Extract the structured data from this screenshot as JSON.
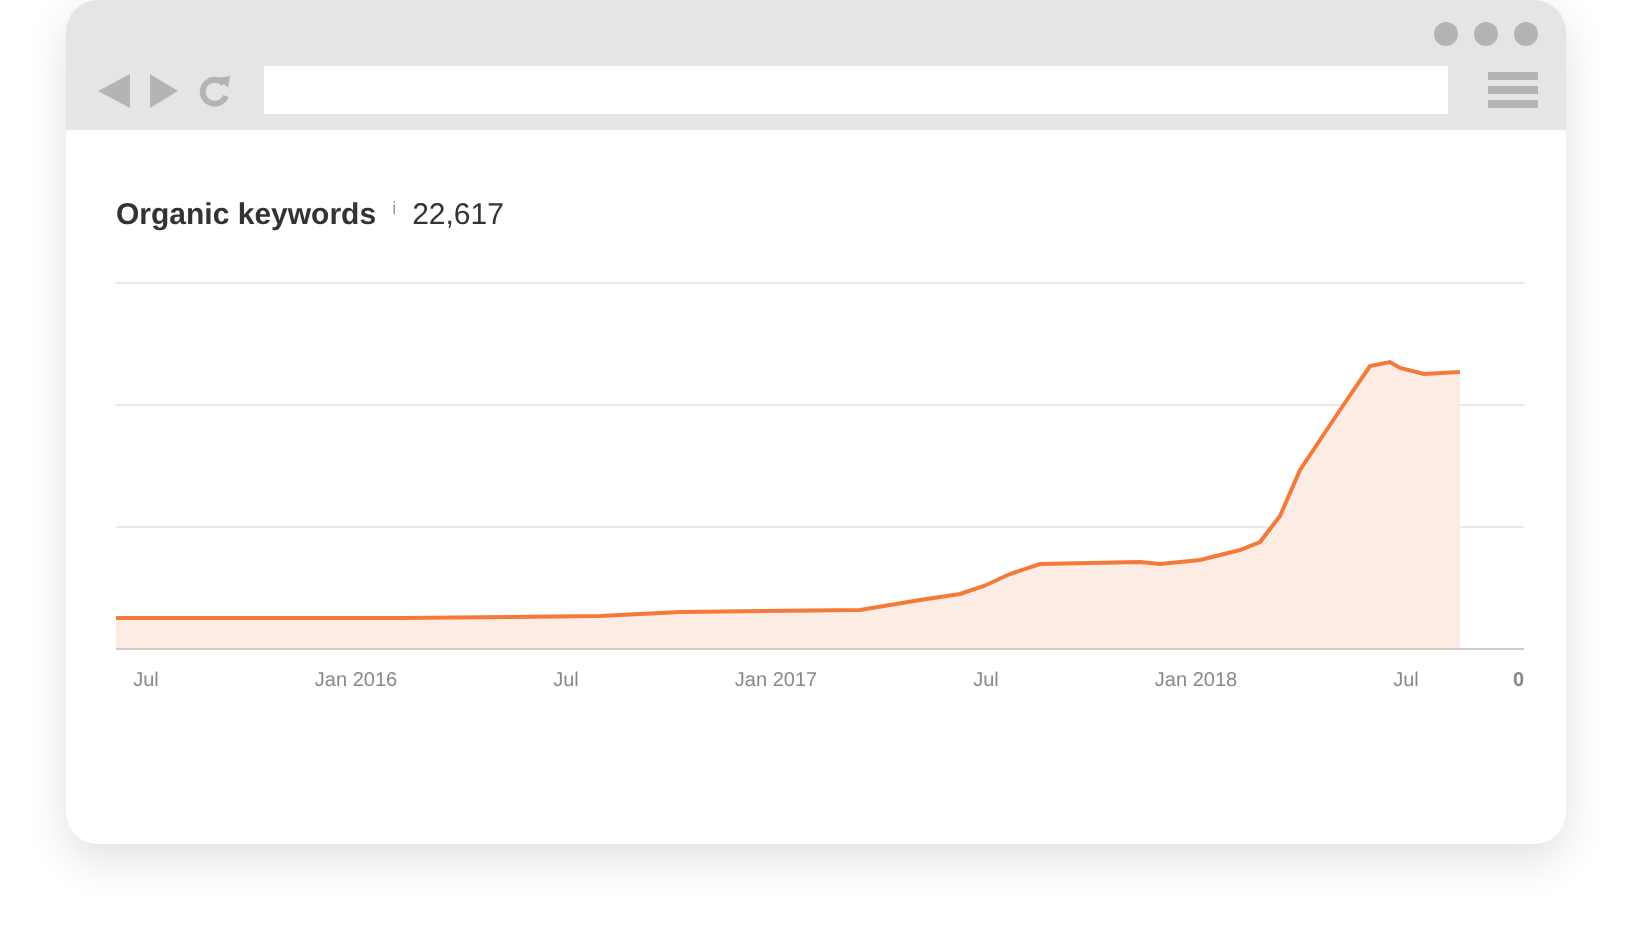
{
  "metric": {
    "title": "Organic keywords",
    "info": "i",
    "value": "22,617"
  },
  "chart": {
    "x_labels": [
      "Jul",
      "Jan 2016",
      "Jul",
      "Jan 2017",
      "Jul",
      "Jan 2018",
      "Jul"
    ],
    "y_label": "0"
  }
}
